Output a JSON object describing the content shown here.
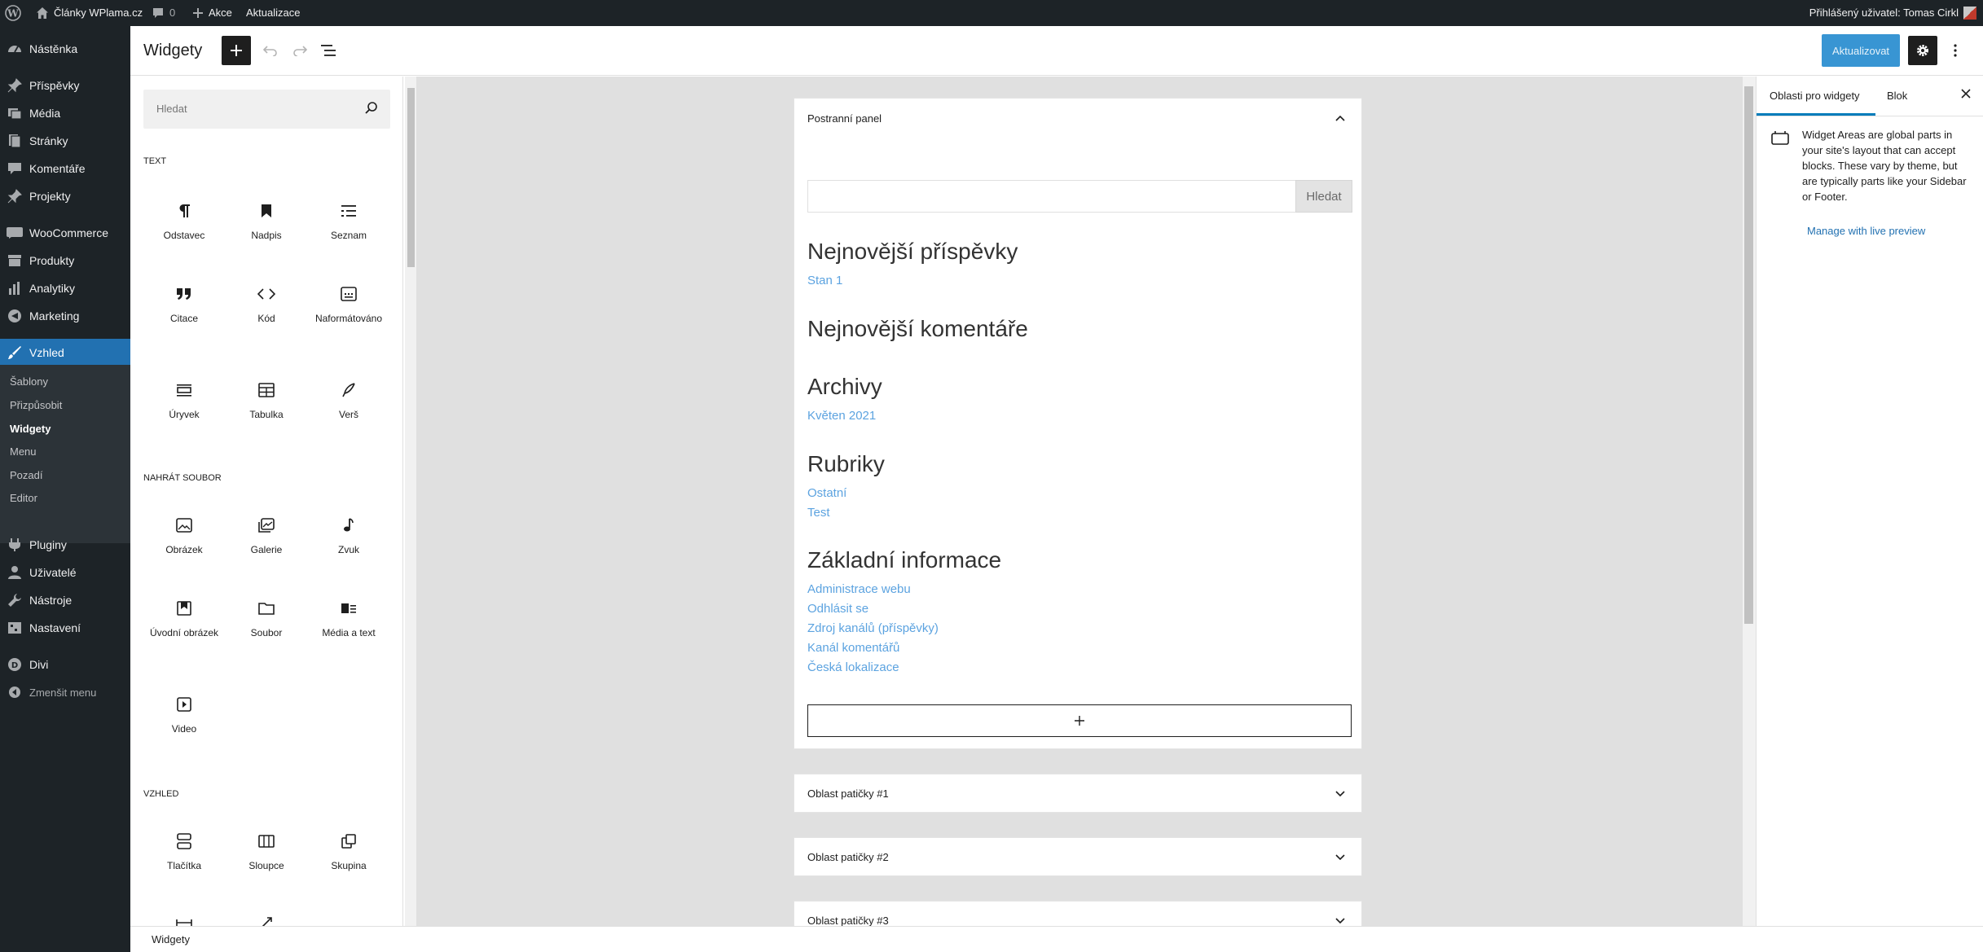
{
  "admin_bar": {
    "site_name": "Články WPlama.cz",
    "comments_count": "0",
    "new_label": "Akce",
    "updates_label": "Aktualizace",
    "user_greeting": "Přihlášený uživatel: Tomas Cirkl"
  },
  "sidebar": {
    "items": [
      {
        "label": "Nástěnka",
        "icon": "dashboard-icon"
      },
      {
        "label": "Příspěvky",
        "icon": "pin-icon"
      },
      {
        "label": "Média",
        "icon": "media-icon"
      },
      {
        "label": "Stránky",
        "icon": "pages-icon"
      },
      {
        "label": "Komentáře",
        "icon": "comment-icon"
      },
      {
        "label": "Projekty",
        "icon": "pin-icon"
      },
      {
        "label": "WooCommerce",
        "icon": "woocommerce-icon"
      },
      {
        "label": "Produkty",
        "icon": "archive-icon"
      },
      {
        "label": "Analytiky",
        "icon": "bar-chart-icon"
      },
      {
        "label": "Marketing",
        "icon": "megaphone-icon"
      },
      {
        "label": "Vzhled",
        "icon": "brush-icon"
      },
      {
        "label": "Pluginy",
        "icon": "plugin-icon"
      },
      {
        "label": "Uživatelé",
        "icon": "user-icon"
      },
      {
        "label": "Nástroje",
        "icon": "wrench-icon"
      },
      {
        "label": "Nastavení",
        "icon": "settings-icon"
      },
      {
        "label": "Divi",
        "icon": "divi-icon"
      },
      {
        "label": "Zmenšit menu",
        "icon": "collapse-icon"
      }
    ],
    "submenu": [
      "Šablony",
      "Přizpůsobit",
      "Widgety",
      "Menu",
      "Pozadí",
      "Editor"
    ],
    "current_submenu": "Widgety"
  },
  "header": {
    "title": "Widgety",
    "update_label": "Aktualizovat"
  },
  "library": {
    "search_placeholder": "Hledat",
    "categories": {
      "text": "Text",
      "media": "Nahrát soubor",
      "design": "Vzhled"
    },
    "blocks": [
      {
        "label": "Odstavec",
        "icon": "paragraph-icon"
      },
      {
        "label": "Nadpis",
        "icon": "heading-icon"
      },
      {
        "label": "Seznam",
        "icon": "list-icon"
      },
      {
        "label": "Citace",
        "icon": "quote-icon"
      },
      {
        "label": "Kód",
        "icon": "code-icon"
      },
      {
        "label": "Naformátováno",
        "icon": "preformatted-icon"
      },
      {
        "label": "Úryvek",
        "icon": "pullquote-icon"
      },
      {
        "label": "Tabulka",
        "icon": "table-icon"
      },
      {
        "label": "Verš",
        "icon": "verse-icon"
      },
      {
        "label": "Obrázek",
        "icon": "image-icon"
      },
      {
        "label": "Galerie",
        "icon": "gallery-icon"
      },
      {
        "label": "Zvuk",
        "icon": "audio-icon"
      },
      {
        "label": "Úvodní obrázek",
        "icon": "cover-icon"
      },
      {
        "label": "Soubor",
        "icon": "file-icon"
      },
      {
        "label": "Média a text",
        "icon": "media-text-icon"
      },
      {
        "label": "Video",
        "icon": "video-icon"
      },
      {
        "label": "Tlačítka",
        "icon": "buttons-icon"
      },
      {
        "label": "Sloupce",
        "icon": "columns-icon"
      },
      {
        "label": "Skupina",
        "icon": "group-icon"
      }
    ]
  },
  "canvas": {
    "sidebar_area": {
      "title": "Postranní panel",
      "search_button": "Hledat",
      "widgets": [
        {
          "heading": "Nejnovější příspěvky",
          "links": [
            "Stan 1"
          ]
        },
        {
          "heading": "Nejnovější komentáře",
          "links": []
        },
        {
          "heading": "Archivy",
          "links": [
            "Květen 2021"
          ]
        },
        {
          "heading": "Rubriky",
          "links": [
            "Ostatní",
            "Test"
          ]
        },
        {
          "heading": "Základní informace",
          "links": [
            "Administrace webu",
            "Odhlásit se",
            "Zdroj kanálů (příspěvky)",
            "Kanál komentářů",
            "Česká lokalizace"
          ]
        }
      ]
    },
    "footer_areas": [
      "Oblast patičky #1",
      "Oblast patičky #2",
      "Oblast patičky #3"
    ]
  },
  "settings_panel": {
    "tabs": [
      "Oblasti pro widgety",
      "Blok"
    ],
    "description": "Widget Areas are global parts in your site's layout that can accept blocks. These vary by theme, but are typically parts like your Sidebar or Footer.",
    "manage_link": "Manage with live preview"
  },
  "footer": {
    "breadcrumb": "Widgety"
  }
}
